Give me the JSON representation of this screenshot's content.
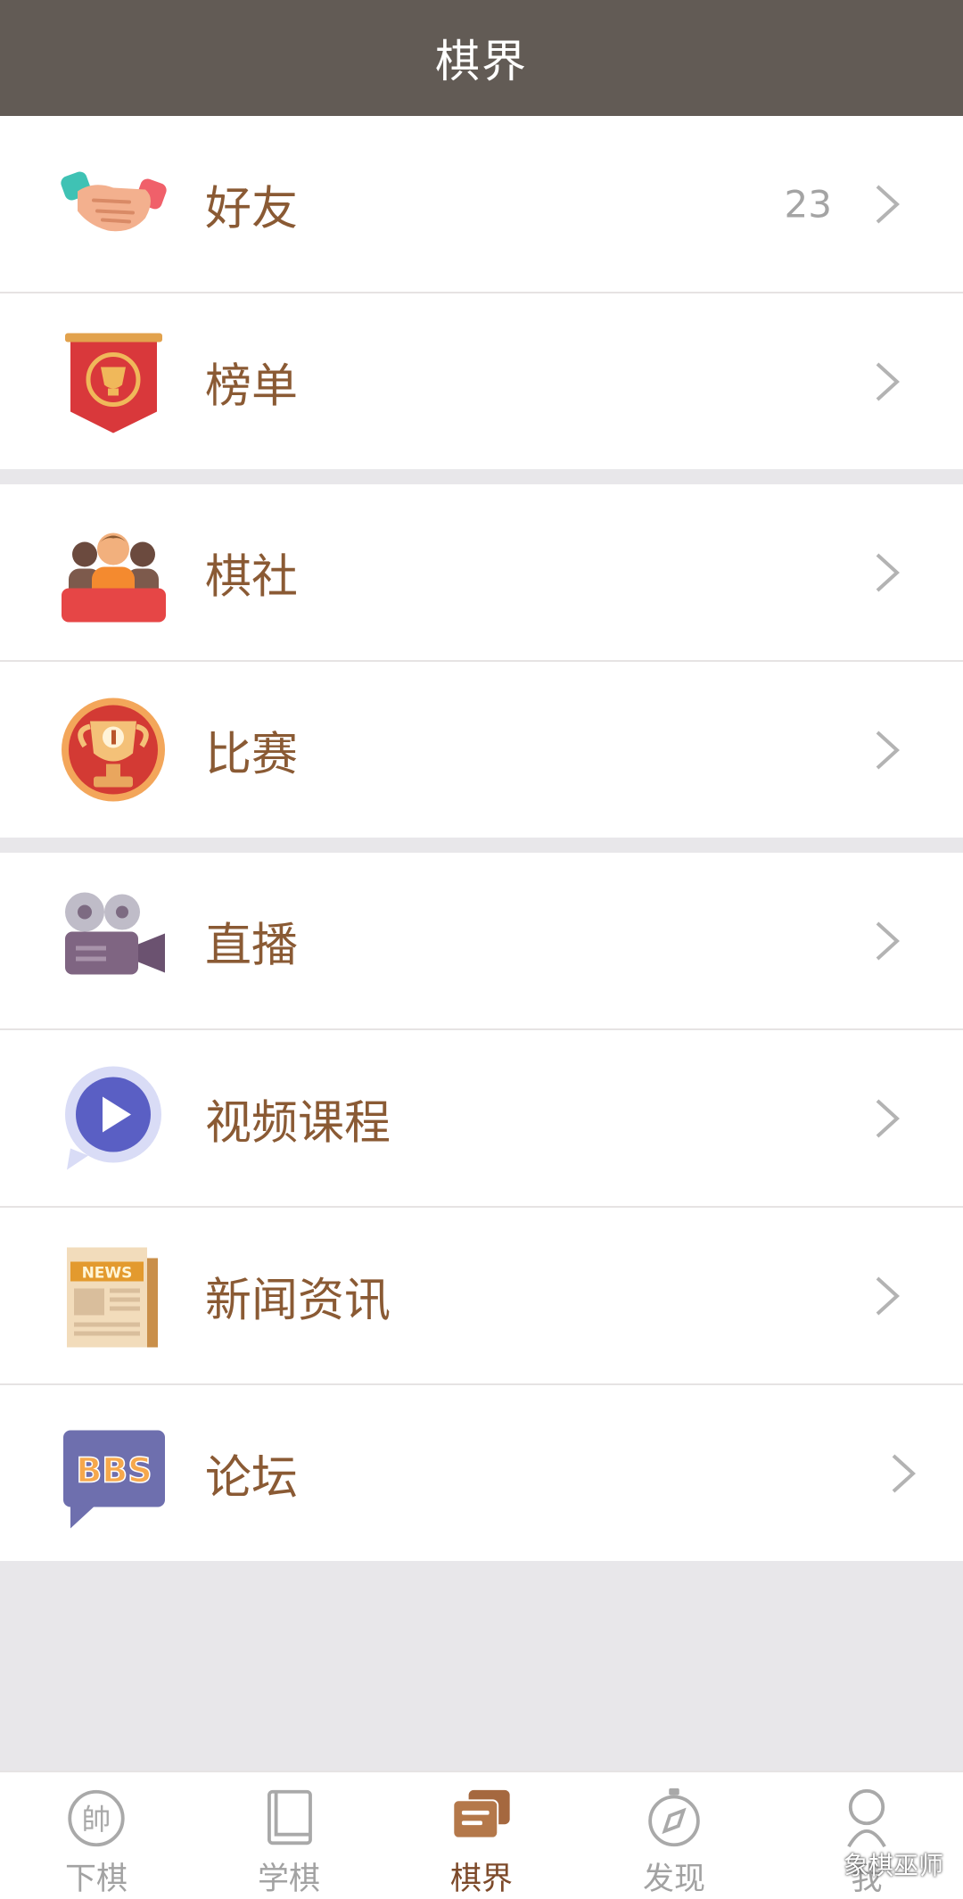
{
  "header": {
    "title": "棋界"
  },
  "group1": [
    {
      "label": "好友",
      "count": "23",
      "icon": "handshake-icon"
    },
    {
      "label": "榜单",
      "count": "",
      "icon": "ranking-banner-icon"
    }
  ],
  "group2": [
    {
      "label": "棋社",
      "icon": "club-vs-icon"
    },
    {
      "label": "比赛",
      "icon": "trophy-icon"
    }
  ],
  "group3": [
    {
      "label": "直播",
      "icon": "video-camera-icon"
    },
    {
      "label": "视频课程",
      "icon": "play-bubble-icon"
    },
    {
      "label": "新闻资讯",
      "icon": "newspaper-icon",
      "icon_text": "NEWS"
    },
    {
      "label": "论坛",
      "icon": "bbs-bubble-icon",
      "icon_text": "BBS"
    }
  ],
  "tabs": [
    {
      "label": "下棋",
      "icon": "chess-piece-icon",
      "icon_text": "帥",
      "active": false
    },
    {
      "label": "学棋",
      "icon": "book-icon",
      "active": false
    },
    {
      "label": "棋界",
      "icon": "chat-cards-icon",
      "active": true
    },
    {
      "label": "发现",
      "icon": "compass-icon",
      "active": false
    },
    {
      "label": "我",
      "icon": "person-icon",
      "active": false
    }
  ],
  "watermark": "象棋巫师",
  "colors": {
    "header_bg": "#625b55",
    "label": "#8a5a34",
    "active_tab": "#7d4a2a",
    "inactive_tab": "#a2a2a2",
    "background": "#e8e7ea"
  }
}
